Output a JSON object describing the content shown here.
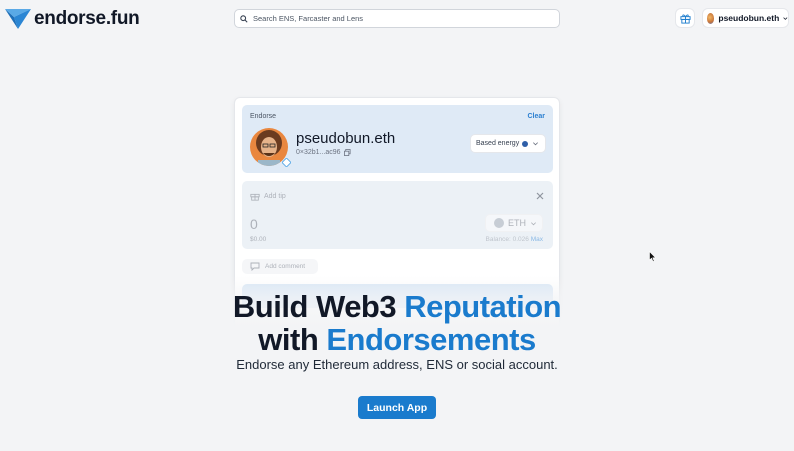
{
  "header": {
    "logo_text": "endorse.fun",
    "search": {
      "placeholder": "Search ENS, Farcaster and Lens"
    },
    "account": {
      "name": "pseudobun.eth"
    },
    "icons": {
      "logo": "endorse-logo-icon",
      "search": "search-icon",
      "gift": "gift-icon",
      "account_chevron": "chevron-down-icon"
    }
  },
  "card": {
    "endorse": {
      "title": "Endorse",
      "clear_label": "Clear",
      "profile_name": "pseudobun.eth",
      "address": "0×32b1...ac96",
      "energy_label": "Based energy",
      "icons": {
        "copy": "copy-icon",
        "verified": "verified-badge-icon",
        "energy": "energy-dot-icon",
        "chevron": "chevron-down-icon"
      }
    },
    "tip": {
      "label": "Add tip",
      "amount": "0",
      "usd_value": "$0.00",
      "currency": "ETH",
      "balance_text": "Balance: 0.026",
      "max_label": "Max",
      "icons": {
        "gift": "gift-icon",
        "close": "close-icon",
        "eth": "eth-icon"
      }
    },
    "comment": {
      "label": "Add comment",
      "icon": "comment-icon"
    }
  },
  "hero": {
    "title_line1_dark": "Build Web3 ",
    "title_line1_blue": "Reputation",
    "title_line2_dark": "with ",
    "title_line2_blue": "Endorsements",
    "subtitle": "Endorse any Ethereum address, ENS or social account.",
    "cta_label": "Launch App"
  },
  "colors": {
    "accent": "#1a7bcd",
    "background": "#f3f4f6",
    "endorse_panel": "#dfeaf6",
    "text_dark": "#111827"
  }
}
